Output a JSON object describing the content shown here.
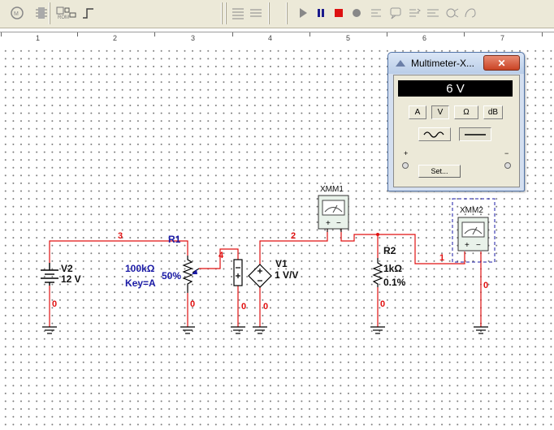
{
  "ruler": {
    "marks": [
      "1",
      "2",
      "3",
      "4",
      "5",
      "6",
      "7"
    ]
  },
  "components": {
    "v2": {
      "name": "V2",
      "value": "12 V"
    },
    "r1": {
      "name": "R1",
      "value": "100kΩ",
      "key": "Key=A",
      "percent": "50%"
    },
    "v1": {
      "name": "V1",
      "value": "1 V/V"
    },
    "r2": {
      "name": "R2",
      "value": "1kΩ",
      "tolerance": "0.1%"
    },
    "xmm1": {
      "name": "XMM1"
    },
    "xmm2": {
      "name": "XMM2"
    }
  },
  "nets": {
    "n0": "0",
    "n1": "1",
    "n2": "2",
    "n3": "3",
    "n4": "4"
  },
  "multimeter": {
    "title": "Multimeter-X...",
    "close": "✕",
    "display": "6 V",
    "btn_a": "A",
    "btn_v": "V",
    "btn_ohm": "Ω",
    "btn_db": "dB",
    "plus": "+",
    "minus": "−",
    "set": "Set..."
  },
  "colors": {
    "wire": "#e01010",
    "component_label": "#1a1aa6",
    "canvas_dot": "#7a7a7a",
    "window_frame": "#5577aa"
  },
  "icons": [
    "multimeter-icon",
    "chip-icon",
    "tri-icon",
    "step-icon",
    "align-icon",
    "run-icon",
    "pause-icon",
    "stop-icon",
    "breakpoint-icon",
    "probe-icon"
  ]
}
